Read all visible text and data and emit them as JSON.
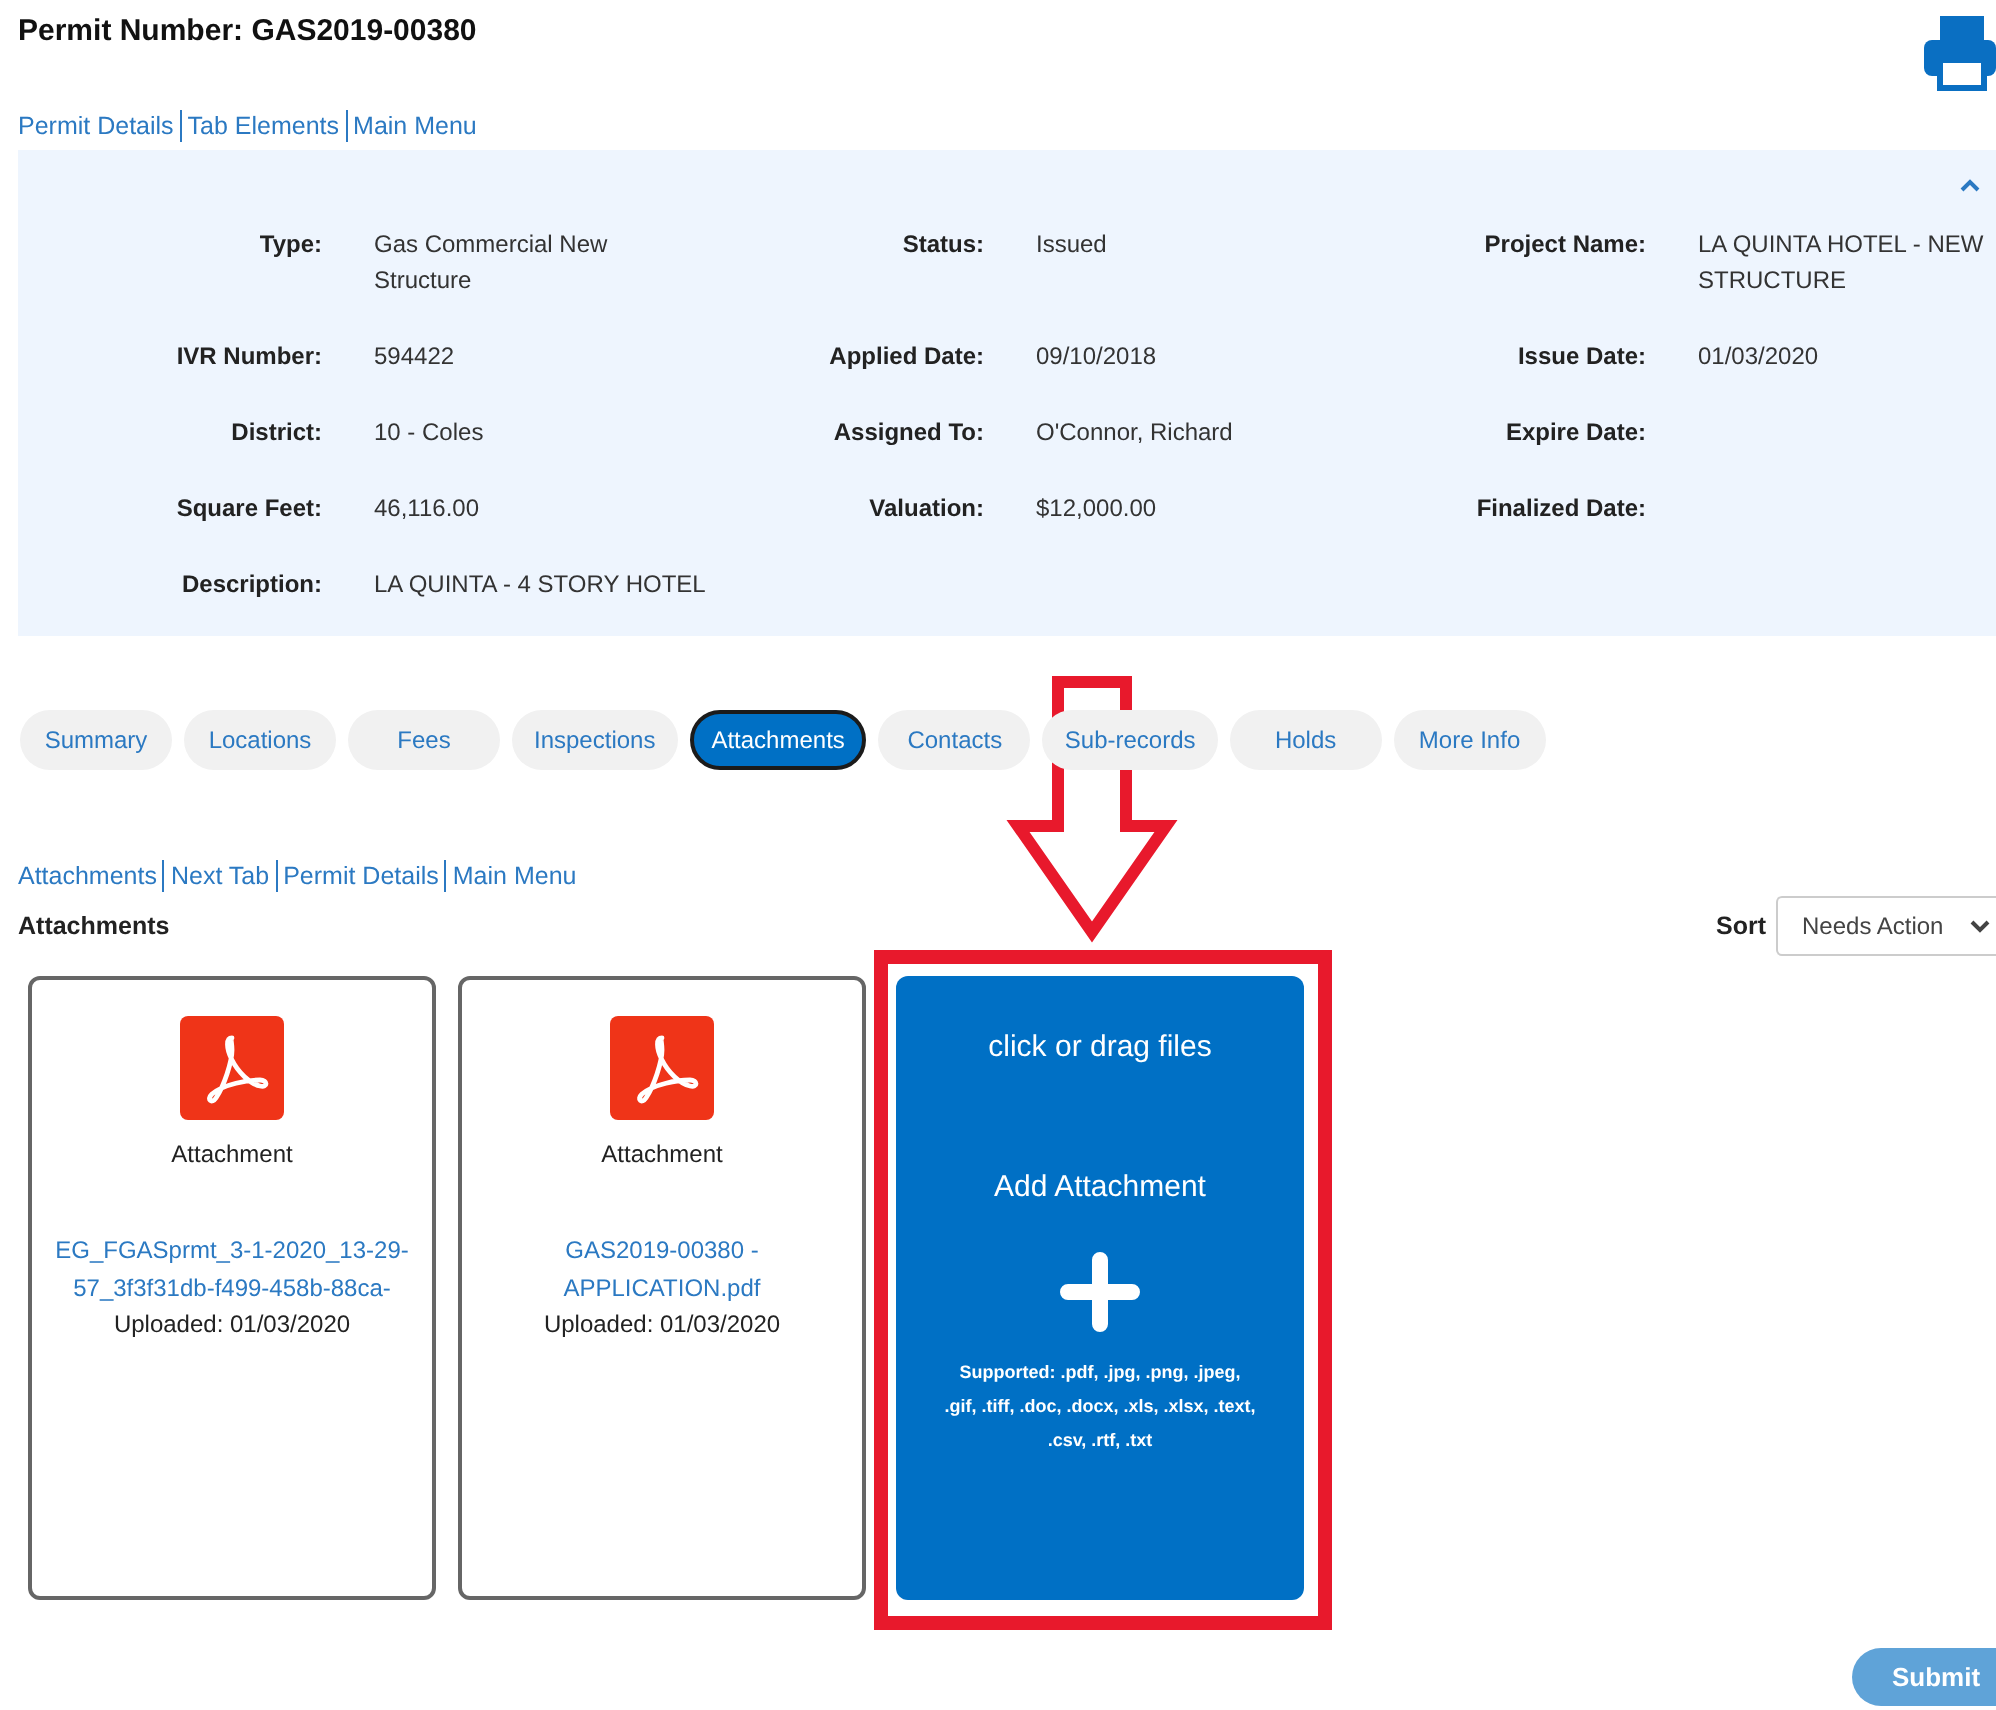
{
  "permit_title": "Permit Number: GAS2019-00380",
  "top_links": [
    "Permit Details",
    "Tab Elements",
    "Main Menu"
  ],
  "details": {
    "expanded": true,
    "fields": [
      {
        "label": "Type:",
        "value": "Gas Commercial New Structure"
      },
      {
        "label": "Status:",
        "value": "Issued"
      },
      {
        "label": "Project Name:",
        "value": "LA QUINTA HOTEL - NEW STRUCTURE"
      },
      {
        "label": "IVR Number:",
        "value": "594422"
      },
      {
        "label": "Applied Date:",
        "value": "09/10/2018"
      },
      {
        "label": "Issue Date:",
        "value": "01/03/2020"
      },
      {
        "label": "District:",
        "value": "10 - Coles"
      },
      {
        "label": "Assigned To:",
        "value": "O'Connor, Richard"
      },
      {
        "label": "Expire Date:"
      },
      {
        "label": "Square Feet:",
        "value": "46,116.00"
      },
      {
        "label": "Valuation:",
        "value": "$12,000.00"
      },
      {
        "label": "Finalized Date:"
      },
      {
        "label": "Description:",
        "value": "LA QUINTA - 4 STORY HOTEL"
      }
    ]
  },
  "tabs": [
    {
      "label": "Summary",
      "selected": false
    },
    {
      "label": "Locations",
      "selected": false
    },
    {
      "label": "Fees",
      "selected": false
    },
    {
      "label": "Inspections",
      "selected": false
    },
    {
      "label": "Attachments",
      "selected": true
    },
    {
      "label": "Contacts",
      "selected": false
    },
    {
      "label": "Sub-records",
      "selected": false
    },
    {
      "label": "Holds",
      "selected": false
    },
    {
      "label": "More Info",
      "selected": false
    }
  ],
  "section_links": [
    "Attachments",
    "Next Tab",
    "Permit Details",
    "Main Menu"
  ],
  "section_title": "Attachments",
  "sort": {
    "label": "Sort",
    "value": "Needs Action"
  },
  "attachments": [
    {
      "type_label": "Attachment",
      "file_name": "EG_FGASprmt_3-1-2020_13-29-57_3f3f31db-f499-458b-88ca-",
      "uploaded": "Uploaded: 01/03/2020"
    },
    {
      "type_label": "Attachment",
      "file_name": "GAS2019-00380 - APPLICATION.pdf",
      "uploaded": "Uploaded: 01/03/2020"
    }
  ],
  "upload_tile": {
    "hint": "click or drag files",
    "title": "Add Attachment",
    "supported": "Supported: .pdf, .jpg, .png, .jpeg, .gif, .tiff, .doc, .docx, .xls, .xlsx, .text, .csv, .rtf, .txt"
  },
  "submit": "Submit"
}
